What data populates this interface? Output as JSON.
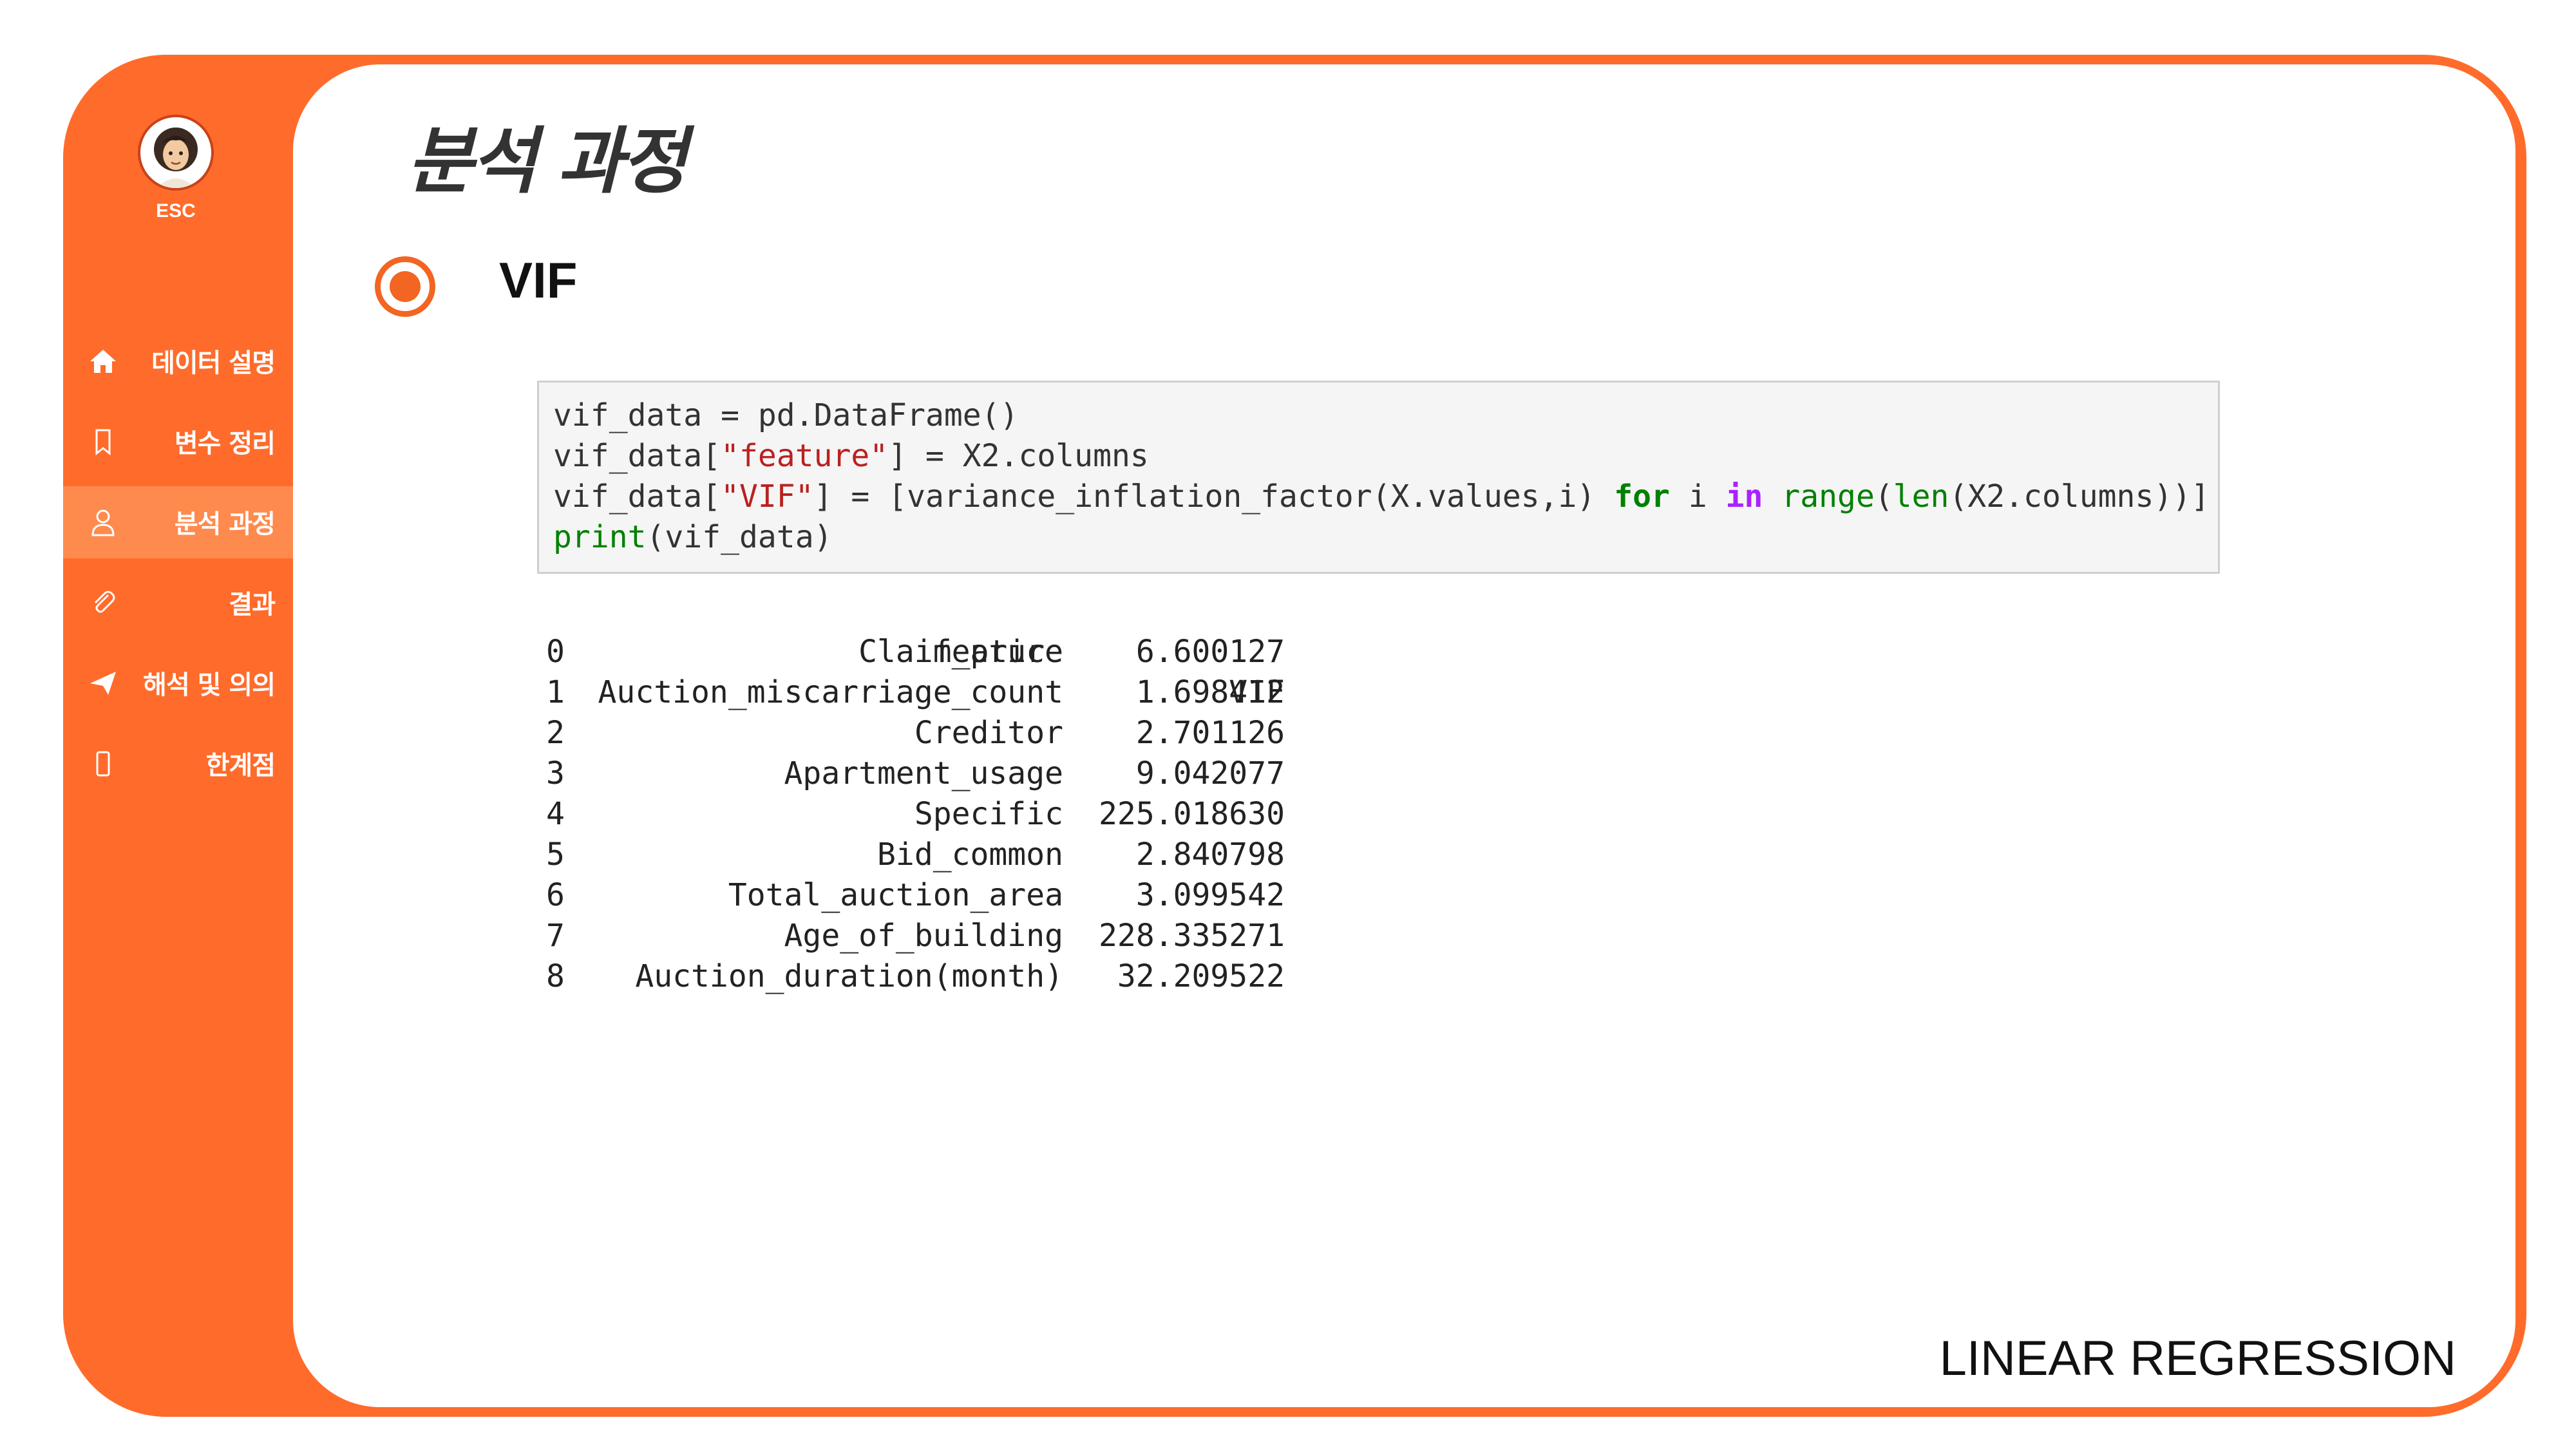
{
  "brand": "ESC",
  "nav": [
    {
      "label": "데이터 설명",
      "icon": "home-icon"
    },
    {
      "label": "변수 정리",
      "icon": "bookmark-icon"
    },
    {
      "label": "분석 과정",
      "icon": "user-icon"
    },
    {
      "label": "결과",
      "icon": "paperclip-icon"
    },
    {
      "label": "해석 및 의의",
      "icon": "send-icon"
    },
    {
      "label": "한계점",
      "icon": "mobile-icon"
    }
  ],
  "active_nav": 2,
  "page": {
    "title": "분석 과정",
    "section": "VIF",
    "footer": "LINEAR REGRESSION"
  },
  "code": {
    "line1": "vif_data = pd.DataFrame()",
    "line2_a": "vif_data[",
    "line2_str": "\"feature\"",
    "line2_b": "] = X2.columns",
    "line3_a": "vif_data[",
    "line3_str": "\"VIF\"",
    "line3_b": "] = [variance_inflation_factor(X.values,i) ",
    "line3_for": "for",
    "line3_c": " i ",
    "line3_in": "in",
    "line3_d": " ",
    "line3_range": "range",
    "line3_e": "(",
    "line3_len": "len",
    "line3_f": "(X2.columns))]",
    "line4_print": "print",
    "line4_rest": "(vif_data)"
  },
  "table": {
    "header_feature": "feature",
    "header_vif": "VIF",
    "rows": [
      {
        "idx": "0",
        "feature": "Claim_price",
        "vif": "6.600127"
      },
      {
        "idx": "1",
        "feature": "Auction_miscarriage_count",
        "vif": "1.698412"
      },
      {
        "idx": "2",
        "feature": "Creditor",
        "vif": "2.701126"
      },
      {
        "idx": "3",
        "feature": "Apartment_usage",
        "vif": "9.042077"
      },
      {
        "idx": "4",
        "feature": "Specific",
        "vif": "225.018630"
      },
      {
        "idx": "5",
        "feature": "Bid_common",
        "vif": "2.840798"
      },
      {
        "idx": "6",
        "feature": "Total_auction_area",
        "vif": "3.099542"
      },
      {
        "idx": "7",
        "feature": "Age_of_building",
        "vif": "228.335271"
      },
      {
        "idx": "8",
        "feature": "Auction_duration(month)",
        "vif": "32.209522"
      }
    ]
  },
  "colors": {
    "accent": "#FF6B2B",
    "active_nav": "#FF8A4D",
    "bullet": "#F26522",
    "code_string": "#BA2121",
    "code_keyword": "#008000",
    "code_operator_word": "#AA22FF"
  }
}
